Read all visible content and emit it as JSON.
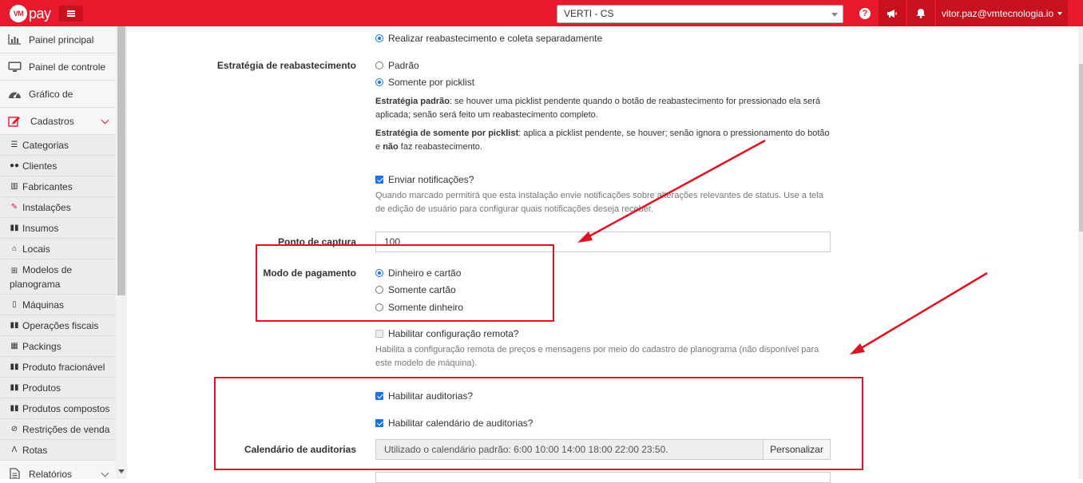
{
  "header": {
    "logo_mark": "VM",
    "logo_text": "pay",
    "org_select_value": "VERTI - CS",
    "help_glyph": "?",
    "user_email": "vitor.paz@vmtecnologia.io",
    "accent_color": "#e8192c",
    "icons": [
      "menu-icon",
      "help-icon",
      "megaphone-icon",
      "bell-icon",
      "caret-down-icon"
    ]
  },
  "sidebar": {
    "items": [
      {
        "label": "Painel principal",
        "icon": "bar-chart-icon"
      },
      {
        "label": "Painel de controle",
        "icon": "monitor-icon"
      },
      {
        "label": "Gráfico de",
        "icon": "dashboard-icon"
      },
      {
        "label": "Cadastros",
        "icon": "edit-icon"
      }
    ],
    "subitems": [
      {
        "label": "Categorias",
        "icon": "list-icon"
      },
      {
        "label": "Clientes",
        "icon": "users-icon"
      },
      {
        "label": "Fabricantes",
        "icon": "building-icon"
      },
      {
        "label": "Instalações",
        "icon": "wrench-icon"
      },
      {
        "label": "Insumos",
        "icon": "barcode-icon"
      },
      {
        "label": "Locais",
        "icon": "home-icon"
      },
      {
        "label": "Modelos de planograma",
        "icon": "table-icon"
      },
      {
        "label": "Máquinas",
        "icon": "mobile-icon"
      },
      {
        "label": "Operações fiscais",
        "icon": "barcode-icon"
      },
      {
        "label": "Packings",
        "icon": "grid-icon"
      },
      {
        "label": "Produto fracionável",
        "icon": "barcode-icon"
      },
      {
        "label": "Produtos",
        "icon": "barcode-icon"
      },
      {
        "label": "Produtos compostos",
        "icon": "barcode-icon"
      },
      {
        "label": "Restrições de venda",
        "icon": "ban-icon"
      },
      {
        "label": "Rotas",
        "icon": "road-icon"
      }
    ],
    "bottom_item": {
      "label": "Relatórios",
      "icon": "document-icon"
    }
  },
  "form": {
    "restock_separate_option": "Realizar reabastecimento e coleta separadamente",
    "restock_strategy": {
      "label": "Estratégia de reabastecimento",
      "options": [
        "Padrão",
        "Somente por picklist"
      ],
      "selected": 1,
      "help_default_title": "Estratégia padrão",
      "help_default_text": ": se houver uma picklist pendente quando o botão de reabastecimento for pressionado ela será aplicada; senão será feito um reabastecimento completo.",
      "help_picklist_title": "Estratégia de somente por picklist",
      "help_picklist_text_a": ": aplica a picklist pendente, se houver; senão ignora o pressionamento do botão e ",
      "help_picklist_text_bold": "não",
      "help_picklist_text_b": " faz reabastecimento."
    },
    "notifications": {
      "label": "Enviar notificações?",
      "checked": true,
      "help": "Quando marcado permitirá que esta instalação envie notificações sobre alterações relevantes de status. Use a tela de edição de usuário para configurar quais notificações deseja receber."
    },
    "capture_point": {
      "label": "Ponto de captura",
      "value": "100"
    },
    "payment_mode": {
      "label": "Modo de pagamento",
      "options": [
        "Dinheiro e cartão",
        "Somente cartão",
        "Somente dinheiro"
      ],
      "selected": 0
    },
    "remote_config": {
      "label": "Habilitar configuração remota?",
      "checked": false,
      "disabled": true,
      "help": "Habilita a configuração remota de preços e mensagens por meio do cadastro de planograma (não disponível para este modelo de máquina)."
    },
    "audits": {
      "label": "Habilitar auditorias?",
      "checked": true
    },
    "audit_calendar_enable": {
      "label": "Habilitar calendário de auditorias?",
      "checked": true
    },
    "audit_calendar": {
      "label": "Calendário de auditorias",
      "value": "Utilizado o calendário padrão: 6:00 10:00 14:00 18:00 22:00 23:50.",
      "button": "Personalizar"
    }
  },
  "annotation_color": "#e3111f"
}
